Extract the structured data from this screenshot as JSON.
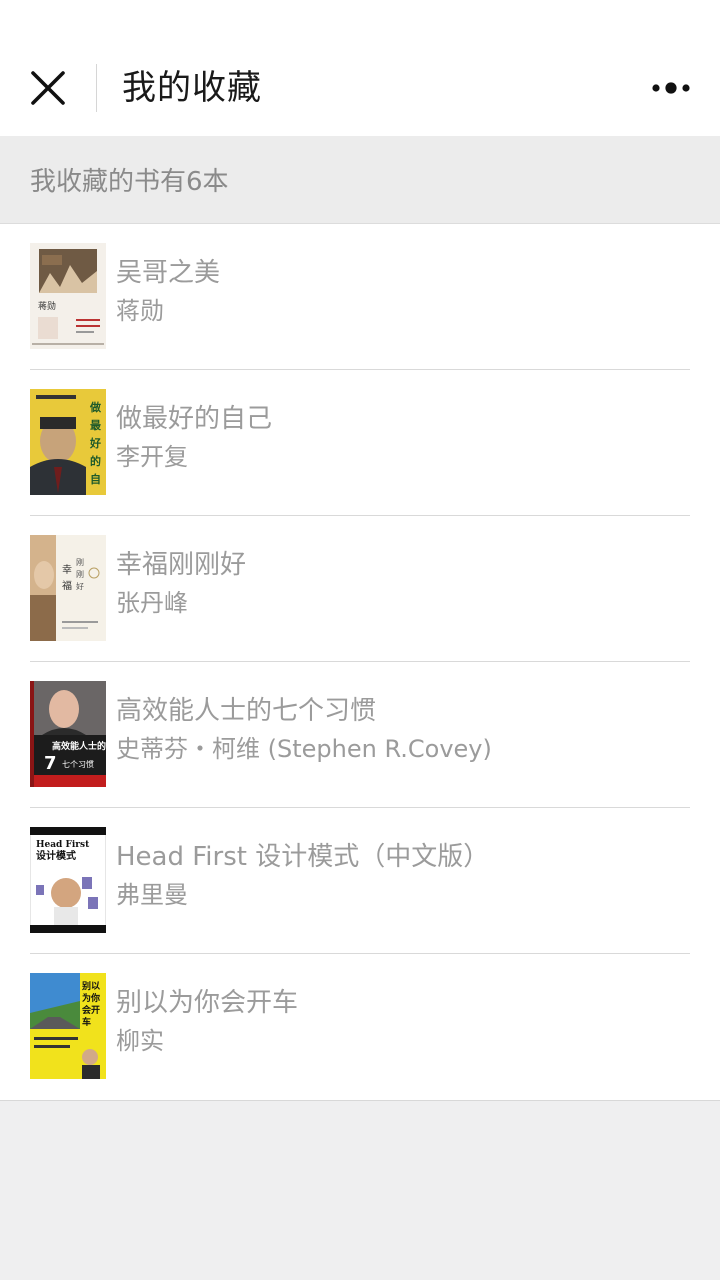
{
  "header": {
    "title": "我的收藏"
  },
  "summary": {
    "text": "我收藏的书有6本"
  },
  "books": [
    {
      "title": "吴哥之美",
      "author": "蒋勋",
      "cover_text": "蒋勋"
    },
    {
      "title": "做最好的自己",
      "author": "李开复",
      "cover_text": "做最好的自己"
    },
    {
      "title": "幸福刚刚好",
      "author": "张丹峰",
      "cover_text": "幸福"
    },
    {
      "title": "高效能人士的七个习惯",
      "author": "史蒂芬・柯维 (Stephen R.Covey)",
      "cover_text": "高效能人士的"
    },
    {
      "title": "Head First 设计模式（中文版）",
      "author": "弗里曼",
      "cover_text": "Head First"
    },
    {
      "title": "别以为你会开车",
      "author": "柳实",
      "cover_text": "别以为你会开车"
    }
  ],
  "icons": {
    "close": "close-icon",
    "more": "more-icon"
  },
  "colors": {
    "header_bg": "#ffffff",
    "page_bg": "#efeff0",
    "summary_bg": "#ececec",
    "secondary_text": "#9b9b9b"
  }
}
